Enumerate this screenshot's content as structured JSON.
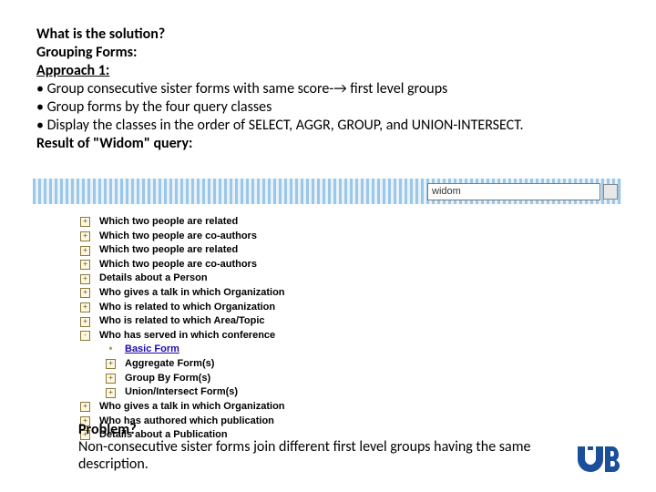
{
  "top": {
    "l1": "What is the solution?",
    "l2": "Grouping Forms:",
    "l3": "Approach 1:",
    "b1": "• Group consecutive sister forms with same score-→ first level groups",
    "b2": "• Group forms by the four query classes",
    "b3": "• Display the classes in the order of SELECT, AGGR, GROUP, and UNION-INTERSECT.",
    "l4": "Result of \"Widom\" query:"
  },
  "search": {
    "value": "widom"
  },
  "tree": [
    {
      "mark": "+",
      "indent": false,
      "text": "Which two people are related",
      "link": false
    },
    {
      "mark": "+",
      "indent": false,
      "text": "Which two people are co-authors",
      "link": false
    },
    {
      "mark": "+",
      "indent": false,
      "text": "Which two people are related",
      "link": false
    },
    {
      "mark": "+",
      "indent": false,
      "text": "Which two people are co-authors",
      "link": false
    },
    {
      "mark": "+",
      "indent": false,
      "text": "Details about a Person",
      "link": false
    },
    {
      "mark": "+",
      "indent": false,
      "text": "Who gives a talk in which Organization",
      "link": false
    },
    {
      "mark": "+",
      "indent": false,
      "text": "Who is related to which Organization",
      "link": false
    },
    {
      "mark": "+",
      "indent": false,
      "text": "Who is related to which Area/Topic",
      "link": false
    },
    {
      "mark": "-",
      "indent": false,
      "text": "Who has served in which conference",
      "link": false
    },
    {
      "mark": "*",
      "indent": true,
      "text": "Basic Form",
      "link": true
    },
    {
      "mark": "+",
      "indent": true,
      "text": "Aggregate Form(s)",
      "link": false
    },
    {
      "mark": "+",
      "indent": true,
      "text": "Group By Form(s)",
      "link": false
    },
    {
      "mark": "+",
      "indent": true,
      "text": "Union/Intersect Form(s)",
      "link": false
    },
    {
      "mark": "+",
      "indent": false,
      "text": "Who gives a talk in which Organization",
      "link": false
    },
    {
      "mark": "+",
      "indent": false,
      "text": "Who has authored which publication",
      "link": false
    },
    {
      "mark": "+",
      "indent": false,
      "text": "Details about a Publication",
      "link": false
    }
  ],
  "bottom": {
    "l1": "Problem?",
    "l2": "Non-consecutive sister forms join different first level groups having the same description."
  }
}
